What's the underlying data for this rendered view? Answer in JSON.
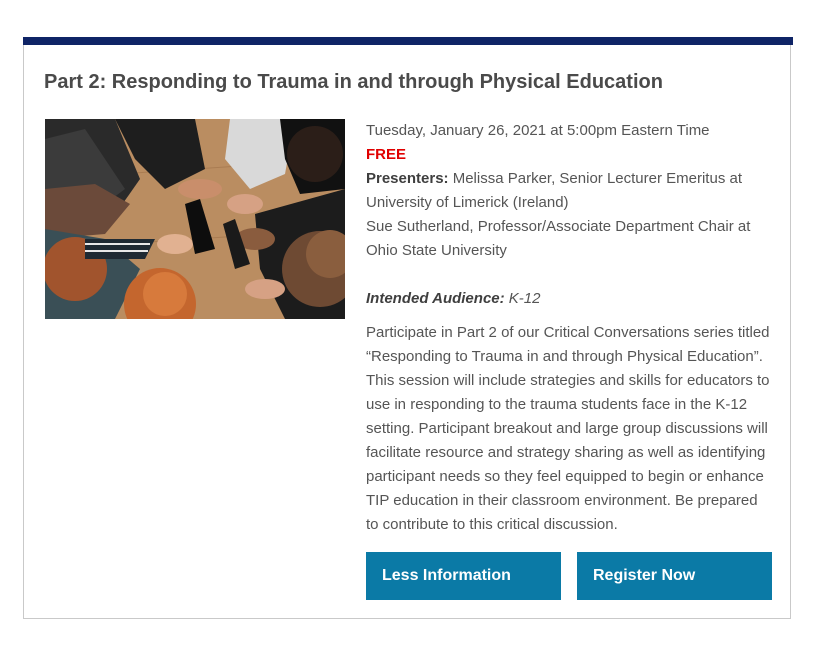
{
  "event": {
    "title": "Part 2: Responding to Trauma in and through Physical Education",
    "datetime": "Tuesday, January 26, 2021 at 5:00pm Eastern Time",
    "price": "FREE",
    "presenters_label": "Presenters:",
    "presenter_1": "Melissa Parker, Senior Lecturer Emeritus at University of Limerick (Ireland)",
    "presenter_2": "Sue Sutherland, Professor/Associate Department Chair at Ohio State University",
    "audience_label": "Intended Audience:",
    "audience_value": "K-12",
    "description": "Participate in Part 2 of our Critical Conversations series titled “Responding to Trauma in and through Physical Education”. This session will include strategies and skills for educators to use in responding to the trauma students face in the K-12 setting. Participant breakout and large group discussions will facilitate resource and strategy sharing as well as identifying participant needs so they feel equipped to begin or enhance TIP education in their classroom environment. Be prepared to contribute to this critical discussion."
  },
  "buttons": {
    "less_info": "Less Information",
    "register": "Register Now"
  },
  "colors": {
    "top_bar": "#0f2466",
    "button": "#0b7aa6",
    "free": "#e00000"
  }
}
